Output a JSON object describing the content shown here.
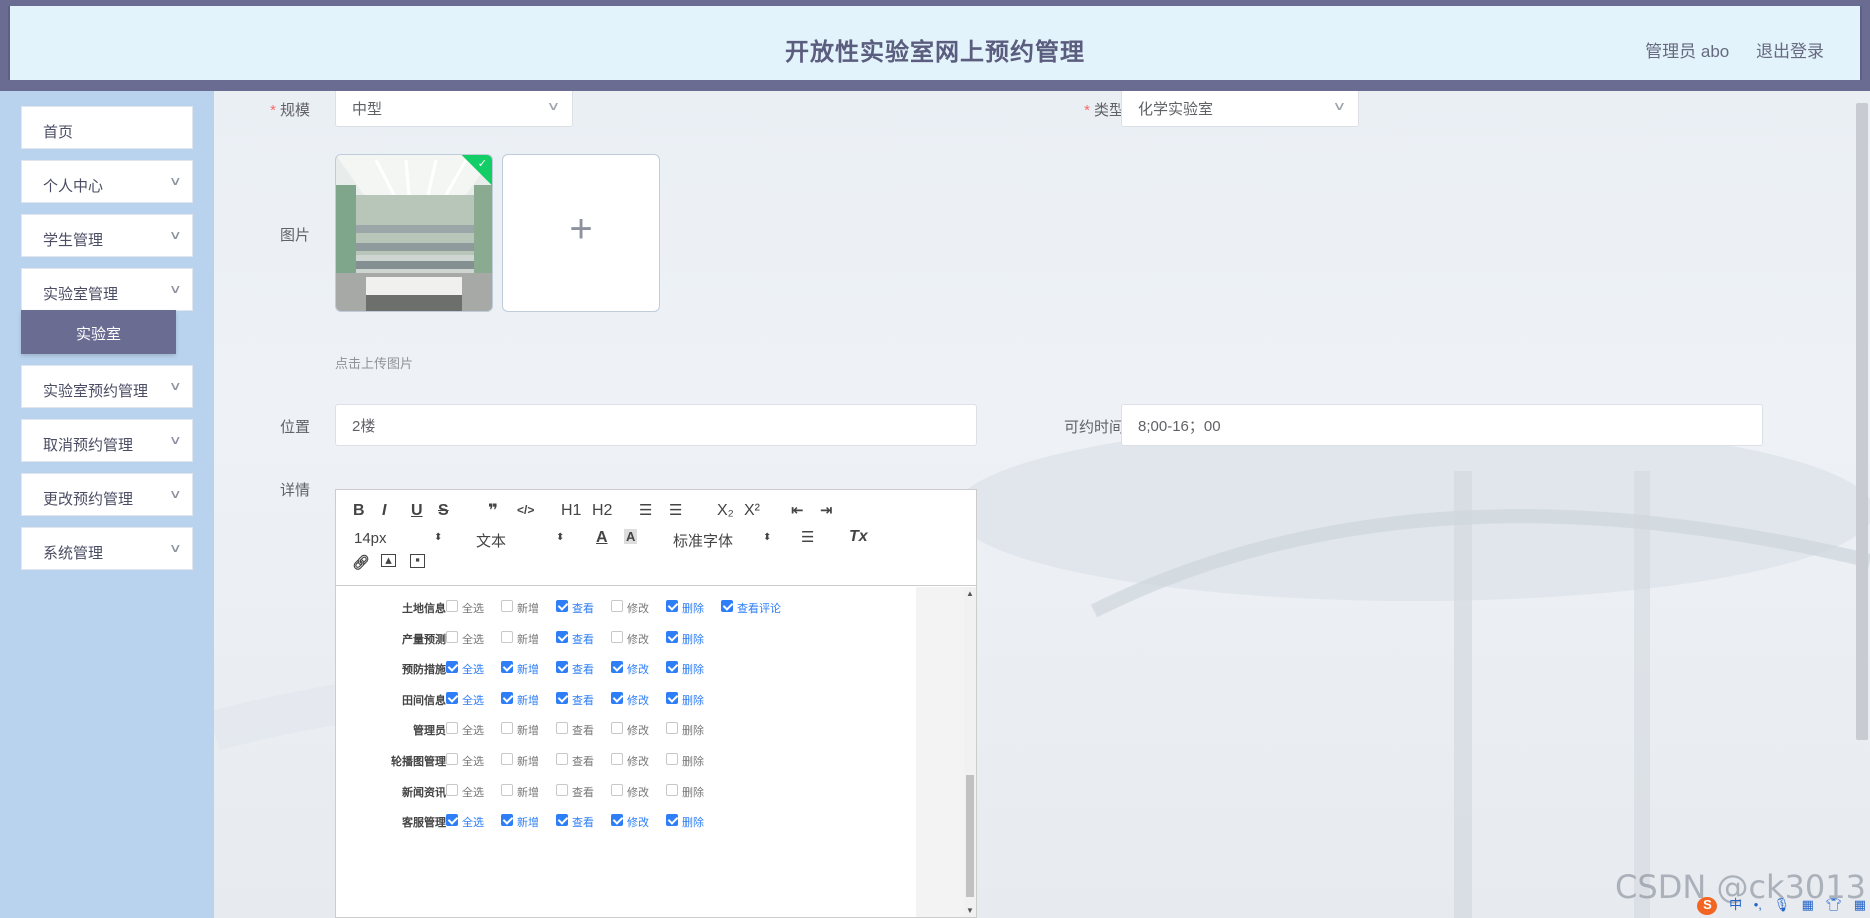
{
  "header": {
    "title": "开放性实验室网上预约管理",
    "user_label": "管理员 abo",
    "logout_label": "退出登录"
  },
  "sidebar": {
    "items": [
      {
        "label": "首页",
        "has_arrow": false
      },
      {
        "label": "个人中心",
        "has_arrow": true
      },
      {
        "label": "学生管理",
        "has_arrow": true
      },
      {
        "label": "实验室管理",
        "has_arrow": true
      },
      {
        "label": "实验室预约管理",
        "has_arrow": true
      },
      {
        "label": "取消预约管理",
        "has_arrow": true
      },
      {
        "label": "更改预约管理",
        "has_arrow": true
      },
      {
        "label": "系统管理",
        "has_arrow": true
      }
    ],
    "active_sub": "实验室"
  },
  "form": {
    "scale_label": "规模",
    "scale_value": "中型",
    "type_label": "类型",
    "type_value": "化学实验室",
    "image_label": "图片",
    "upload_hint": "点击上传图片",
    "location_label": "位置",
    "location_value": "2楼",
    "time_label": "可约时间",
    "time_value": "8;00-16；00",
    "detail_label": "详情"
  },
  "editor": {
    "toolbar": {
      "bold": "B",
      "italic": "I",
      "underline": "U",
      "strike": "S",
      "quote": "❞",
      "code": "</>",
      "h1": "H1",
      "h2": "H2",
      "sub": "X₂",
      "sup": "X²",
      "size": "14px",
      "text_type": "文本",
      "color": "A",
      "bg": "A",
      "font": "标准字体",
      "clean": "Tx"
    },
    "perm_rows": [
      {
        "name": "土地信息",
        "checks": [
          [
            "全选",
            false
          ],
          [
            "新增",
            false
          ],
          [
            "查看",
            true
          ],
          [
            "修改",
            false
          ],
          [
            "删除",
            true
          ],
          [
            "查看评论",
            true
          ]
        ]
      },
      {
        "name": "产量预测",
        "checks": [
          [
            "全选",
            false
          ],
          [
            "新增",
            false
          ],
          [
            "查看",
            true
          ],
          [
            "修改",
            false
          ],
          [
            "删除",
            true
          ]
        ]
      },
      {
        "name": "预防措施",
        "checks": [
          [
            "全选",
            true
          ],
          [
            "新增",
            true
          ],
          [
            "查看",
            true
          ],
          [
            "修改",
            true
          ],
          [
            "删除",
            true
          ]
        ]
      },
      {
        "name": "田间信息",
        "checks": [
          [
            "全选",
            true
          ],
          [
            "新增",
            true
          ],
          [
            "查看",
            true
          ],
          [
            "修改",
            true
          ],
          [
            "删除",
            true
          ]
        ]
      },
      {
        "name": "管理员",
        "checks": [
          [
            "全选",
            false
          ],
          [
            "新增",
            false
          ],
          [
            "查看",
            false
          ],
          [
            "修改",
            false
          ],
          [
            "删除",
            false
          ]
        ]
      },
      {
        "name": "轮播图管理",
        "checks": [
          [
            "全选",
            false
          ],
          [
            "新增",
            false
          ],
          [
            "查看",
            false
          ],
          [
            "修改",
            false
          ],
          [
            "删除",
            false
          ]
        ]
      },
      {
        "name": "新闻资讯",
        "checks": [
          [
            "全选",
            false
          ],
          [
            "新增",
            false
          ],
          [
            "查看",
            false
          ],
          [
            "修改",
            false
          ],
          [
            "删除",
            false
          ]
        ]
      },
      {
        "name": "客服管理",
        "checks": [
          [
            "全选",
            true
          ],
          [
            "新增",
            true
          ],
          [
            "查看",
            true
          ],
          [
            "修改",
            true
          ],
          [
            "删除",
            true
          ]
        ]
      }
    ]
  },
  "watermark": "CSDN @ck3013",
  "ime": {
    "logo": "S",
    "lang": "中"
  },
  "colors": {
    "header_bg": "#6a6c92",
    "header_inner": "#e3f3fb",
    "sidebar_bg": "#b9d3ef",
    "active_sub_bg": "#6a6c92",
    "checkbox_on": "#2d7ef7",
    "required": "#f56c6c"
  }
}
